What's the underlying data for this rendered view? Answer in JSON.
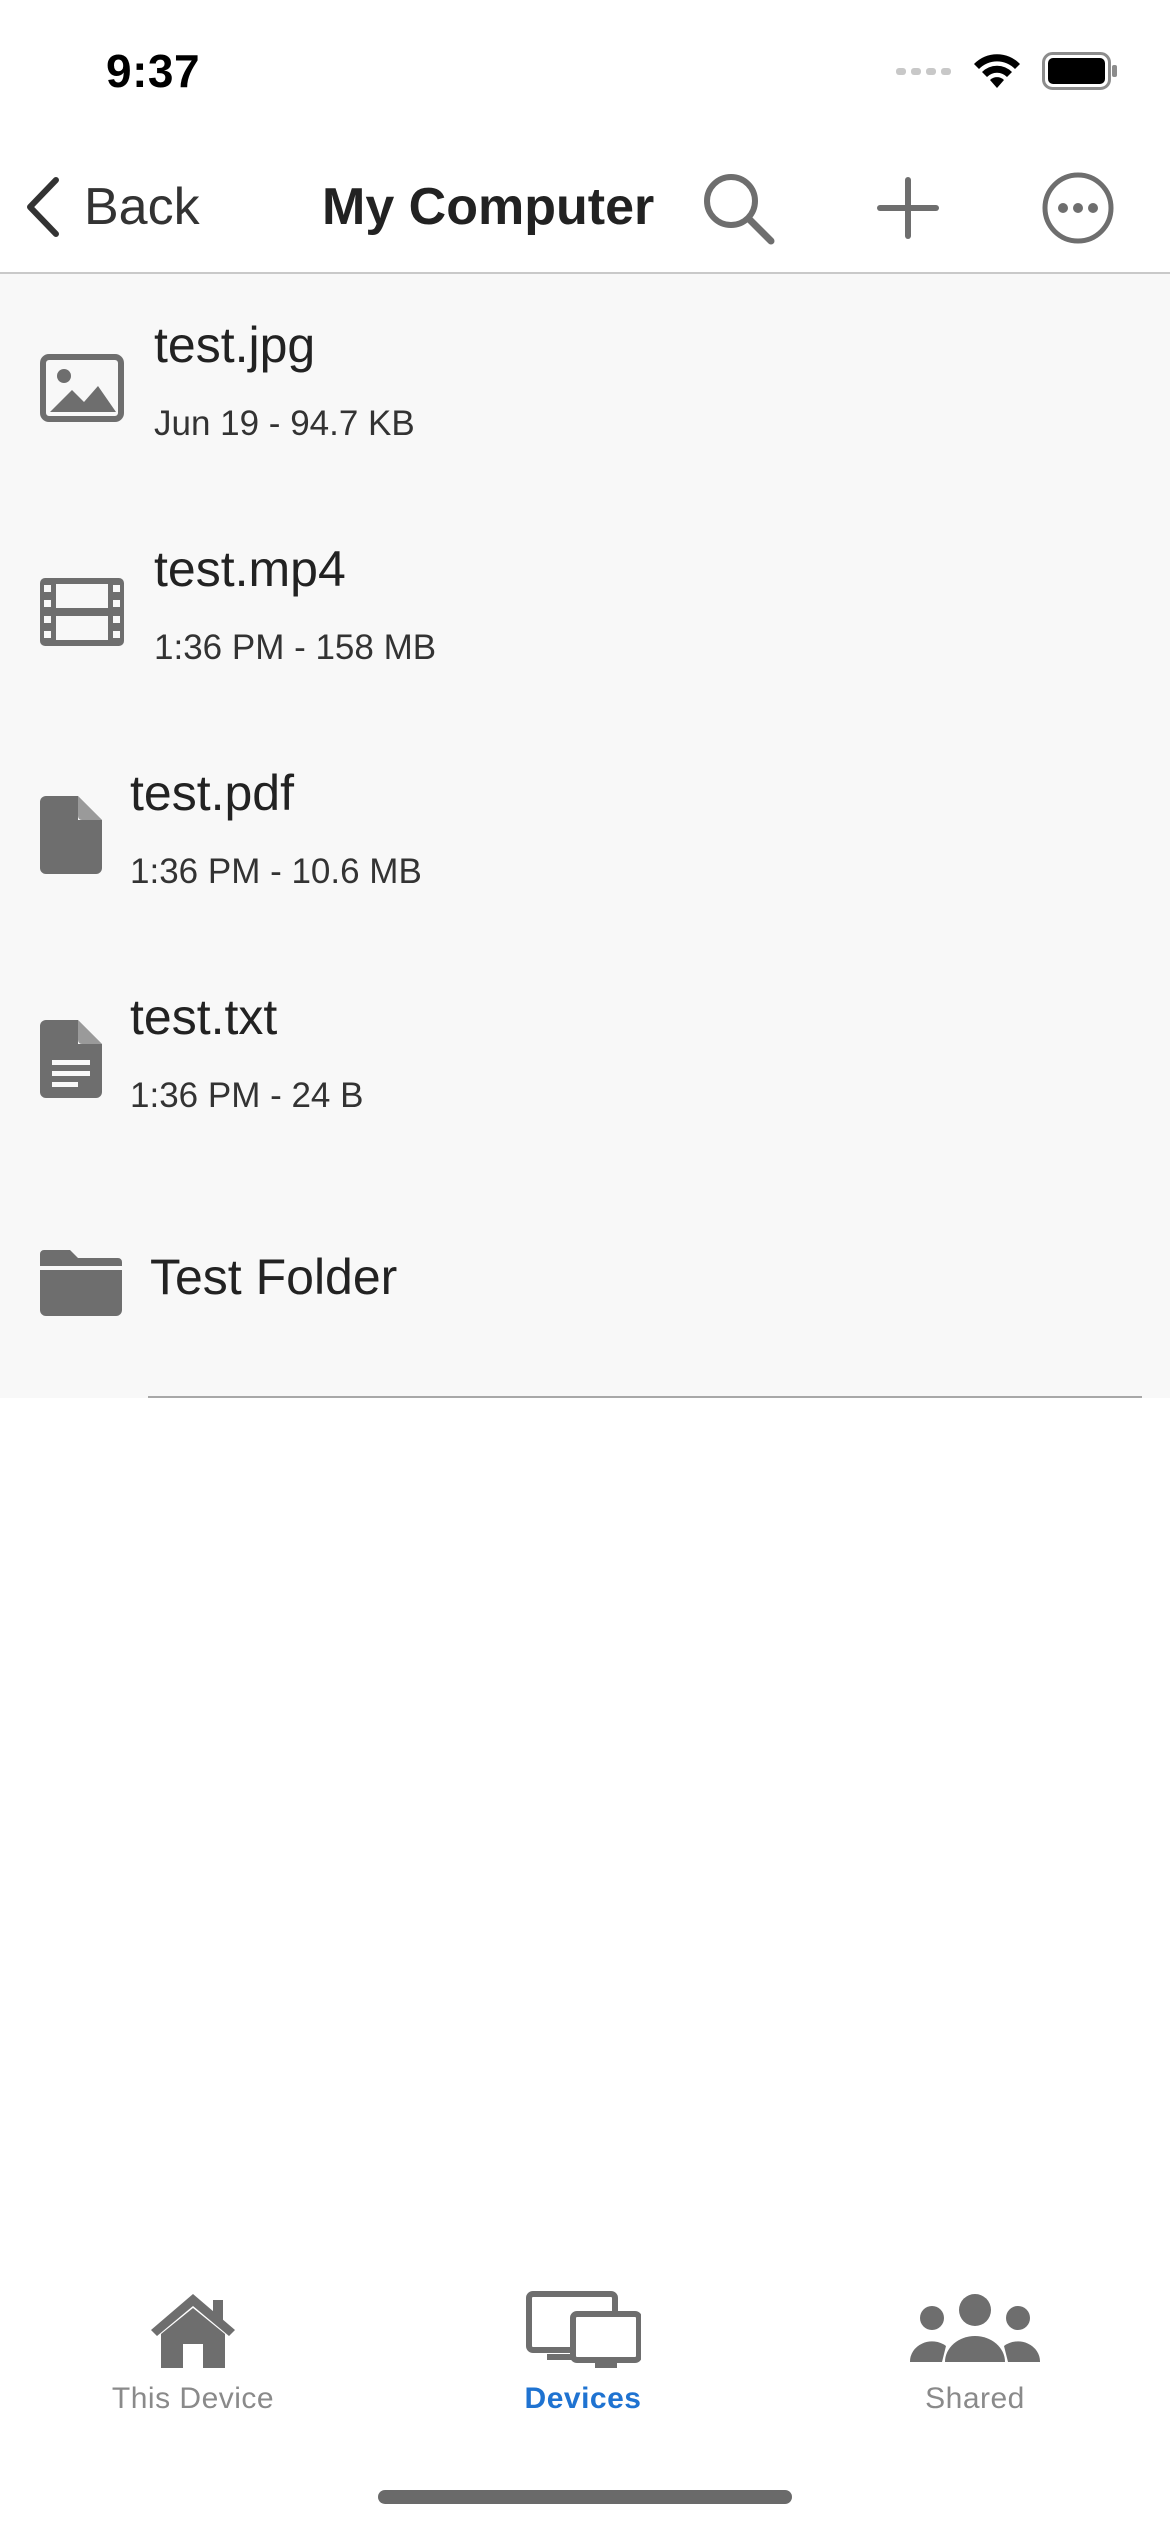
{
  "status_bar": {
    "time": "9:37"
  },
  "nav": {
    "back_label": "Back",
    "title": "My Computer",
    "icons": [
      "chevron-left-icon",
      "search-icon",
      "plus-icon",
      "more-circle-icon"
    ]
  },
  "files": [
    {
      "name": "test.jpg",
      "meta": "Jun 19 - 94.7 KB",
      "icon": "image-icon"
    },
    {
      "name": "test.mp4",
      "meta": "1:36 PM - 158 MB",
      "icon": "film-icon"
    },
    {
      "name": "test.pdf",
      "meta": "1:36 PM - 10.6 MB",
      "icon": "document-icon"
    },
    {
      "name": "test.txt",
      "meta": "1:36 PM - 24 B",
      "icon": "text-document-icon"
    },
    {
      "name": "Test Folder",
      "icon": "folder-icon"
    }
  ],
  "tabs": [
    {
      "label": "This Device",
      "icon": "house-icon",
      "active": false
    },
    {
      "label": "Devices",
      "icon": "devices-icon",
      "active": true
    },
    {
      "label": "Shared",
      "icon": "people-icon",
      "active": false
    }
  ],
  "colors": {
    "accent": "#1f73d1",
    "icon_gray": "#6e6e6e",
    "list_background": "#f8f8f8"
  }
}
